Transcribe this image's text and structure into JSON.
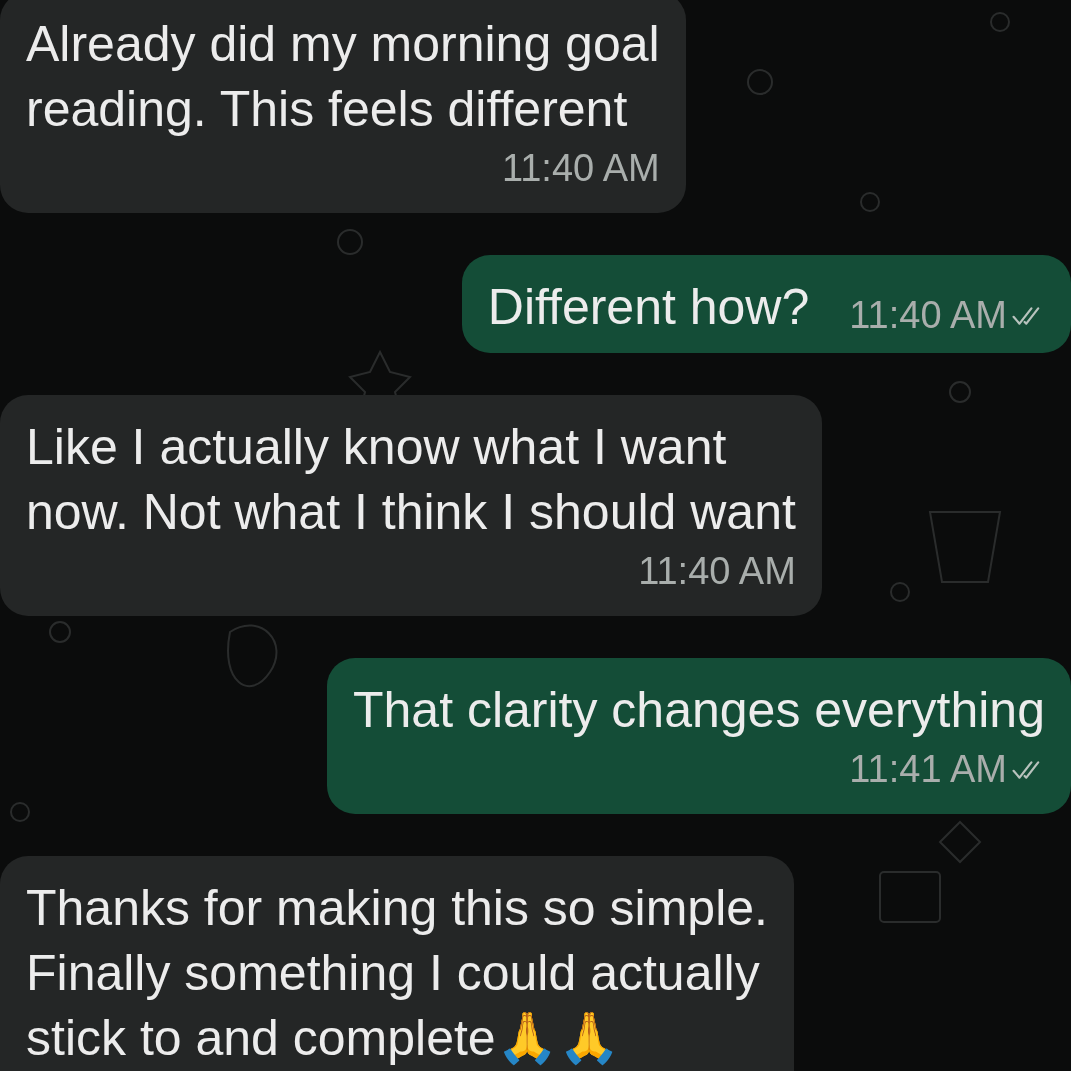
{
  "messages": [
    {
      "kind": "received",
      "lines": [
        "Already did my morning goal",
        "reading. This feels different"
      ],
      "time": "11:40 AM"
    },
    {
      "kind": "sent",
      "lines": [
        "Different how?"
      ],
      "time": "11:40 AM",
      "read": false
    },
    {
      "kind": "received",
      "lines": [
        "Like I actually know what I want",
        "now. Not what I think I should want"
      ],
      "time": "11:40 AM"
    },
    {
      "kind": "sent",
      "lines": [
        "That clarity changes everything"
      ],
      "time": "11:41 AM",
      "read": false
    },
    {
      "kind": "received",
      "lines": [
        "Thanks for making this so simple.",
        "Finally something I could actually",
        "stick to and complete🙏🙏"
      ]
    }
  ]
}
